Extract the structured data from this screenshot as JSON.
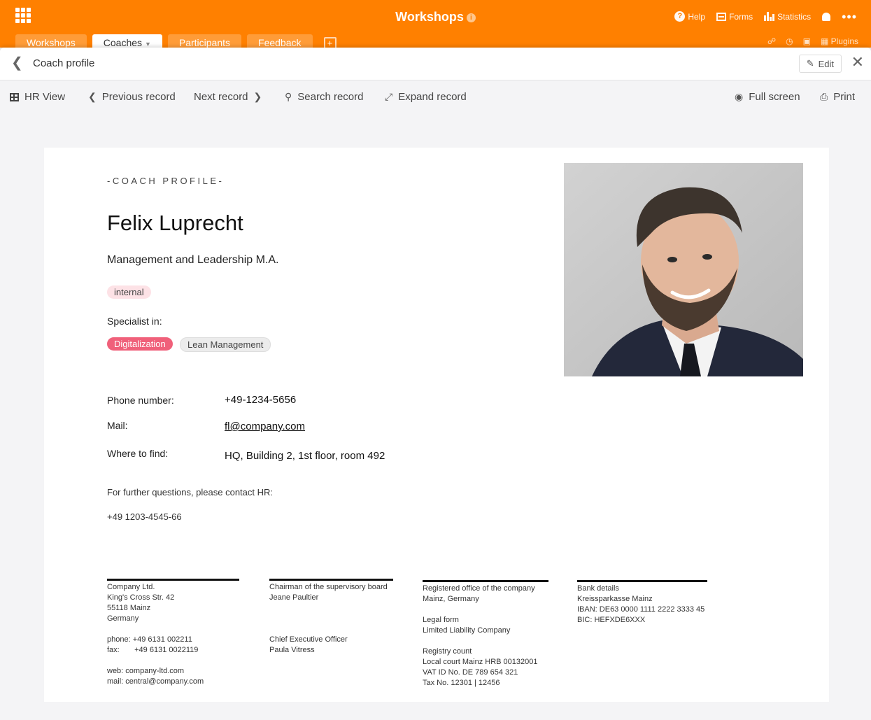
{
  "app": {
    "title": "Workshops",
    "tabs": [
      {
        "label": "Workshops",
        "active": false
      },
      {
        "label": "Coaches",
        "active": true
      },
      {
        "label": "Participants",
        "active": false
      },
      {
        "label": "Feedback",
        "active": false
      }
    ],
    "actions": {
      "help": "Help",
      "forms": "Forms",
      "statistics": "Statistics"
    },
    "plugins_label": "Plugins",
    "accent": "#ff8000"
  },
  "modal": {
    "title": "Coach profile",
    "edit_label": "Edit"
  },
  "toolbar": {
    "view": "HR View",
    "previous": "Previous record",
    "next": "Next record",
    "search": "Search record",
    "expand": "Expand record",
    "fullscreen": "Full screen",
    "print": "Print"
  },
  "profile": {
    "eyebrow": "-COACH PROFILE-",
    "name": "Felix Luprecht",
    "degree": "Management and Leadership M.A.",
    "status_badge": "internal",
    "specialist_label": "Specialist in:",
    "specialties": [
      "Digitalization",
      "Lean Management"
    ],
    "phone_label": "Phone number:",
    "phone": "+49-1234-5656",
    "mail_label": "Mail:",
    "mail": "fl@company.com",
    "location_label": "Where to find:",
    "location": "HQ, Building 2, 1st floor, room 492",
    "further": "For further questions, please contact HR:",
    "hr_phone": "+49 1203-4545-66"
  },
  "footer": {
    "col1": [
      "Company Ltd.",
      "King's Cross Str. 42",
      "55118 Mainz",
      "Germany",
      "",
      "phone: +49 6131 002211",
      "fax:       +49 6131 0022119",
      "",
      "web: company-ltd.com",
      "mail: central@company.com"
    ],
    "col2": [
      "Chairman of the supervisory board",
      "Jeane Paultier",
      "",
      "",
      "",
      "Chief Executive Officer",
      "Paula Vitress"
    ],
    "col3": [
      "Registered office of the company",
      "Mainz, Germany",
      "",
      "Legal form",
      "Limited Liability Company",
      "",
      "Registry count",
      "Local court Mainz HRB 00132001",
      "VAT ID No. DE 789 654 321",
      "Tax No. 12301 | 12456"
    ],
    "col4": [
      "Bank details",
      "Kreissparkasse Mainz",
      "IBAN: DE63 0000 1111 2222 3333 45",
      "BIC: HEFXDE6XXX"
    ]
  }
}
